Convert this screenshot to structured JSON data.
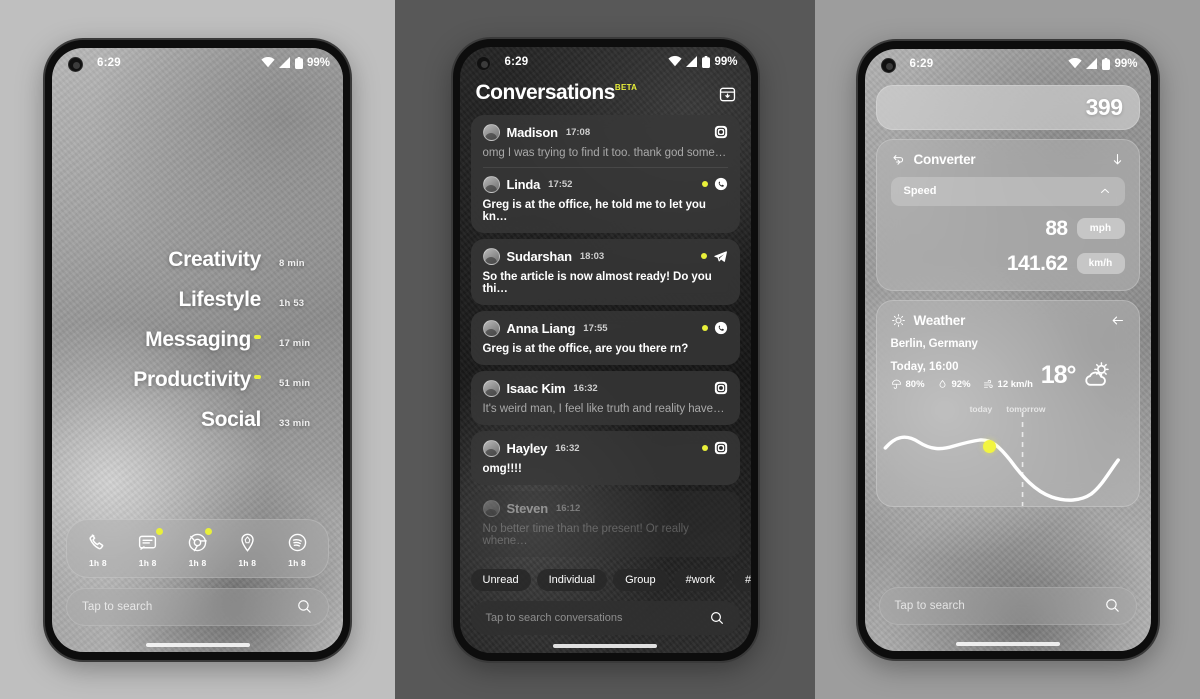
{
  "status_bar": {
    "time": "6:29",
    "battery": "99%",
    "wifi_icon": "wifi-icon",
    "signal_icon": "signal-icon",
    "battery_icon": "battery-icon"
  },
  "accent_color": "#e9f03a",
  "phone1": {
    "categories": [
      {
        "name": "Creativity",
        "time": "8 min",
        "dot": false
      },
      {
        "name": "Lifestyle",
        "time": "1h 53",
        "dot": false
      },
      {
        "name": "Messaging",
        "time": "17 min",
        "dot": true
      },
      {
        "name": "Productivity",
        "time": "51 min",
        "dot": true
      },
      {
        "name": "Social",
        "time": "33 min",
        "dot": false
      }
    ],
    "dock": [
      {
        "icon": "phone-icon",
        "label": "1h 8",
        "badge": false
      },
      {
        "icon": "messages-icon",
        "label": "1h 8",
        "badge": true
      },
      {
        "icon": "chrome-icon",
        "label": "1h 8",
        "badge": true
      },
      {
        "icon": "maps-icon",
        "label": "1h 8",
        "badge": false
      },
      {
        "icon": "spotify-icon",
        "label": "1h 8",
        "badge": false
      }
    ],
    "search": {
      "placeholder": "Tap to search",
      "icon": "search-icon"
    }
  },
  "phone2": {
    "header": {
      "title": "Conversations",
      "badge": "BETA",
      "archive_icon": "archive-icon"
    },
    "conversations": [
      {
        "name": "Madison",
        "time": "17:08",
        "message": "omg I was trying to find it too. thank god some…",
        "app_icon": "instagram-icon",
        "unread": false,
        "grouped_with_next": true
      },
      {
        "name": "Linda",
        "time": "17:52",
        "message": "Greg is at the office, he told me to let you kn…",
        "app_icon": "whatsapp-icon",
        "unread": true,
        "grouped_with_next": false
      },
      {
        "name": "Sudarshan",
        "time": "18:03",
        "message": "So the article is now almost ready! Do you thi…",
        "app_icon": "telegram-icon",
        "unread": true,
        "grouped_with_next": false
      },
      {
        "name": "Anna Liang",
        "time": "17:55",
        "message": "Greg is at the office, are you there rn?",
        "app_icon": "whatsapp-icon",
        "unread": true,
        "grouped_with_next": false
      },
      {
        "name": "Isaac Kim",
        "time": "16:32",
        "message": "It's weird man, I feel like truth and reality have…",
        "app_icon": "instagram-icon",
        "unread": false,
        "grouped_with_next": false
      },
      {
        "name": "Hayley",
        "time": "16:32",
        "message": "omg!!!!",
        "app_icon": "instagram-icon",
        "unread": true,
        "grouped_with_next": false
      },
      {
        "name": "Steven",
        "time": "16:12",
        "message": "No better time than the present! Or really whene…",
        "app_icon": "instagram-icon",
        "unread": false,
        "grouped_with_next": false
      }
    ],
    "filters": [
      "Unread",
      "Individual",
      "Group",
      "#work",
      "#fam"
    ],
    "search": {
      "placeholder": "Tap to search conversations",
      "icon": "search-icon"
    }
  },
  "phone3": {
    "calculator": {
      "value": "399"
    },
    "converter": {
      "title": "Converter",
      "icon": "convert-icon",
      "collapse_icon": "arrow-down-icon",
      "category": "Speed",
      "category_chevron": "chevron-up-icon",
      "rows": [
        {
          "value": "88",
          "unit": "mph"
        },
        {
          "value": "141.62",
          "unit": "km/h"
        }
      ]
    },
    "weather": {
      "title": "Weather",
      "icon": "sun-icon",
      "back_icon": "arrow-left-icon",
      "location": "Berlin, Germany",
      "time_label": "Today, 16:00",
      "stats": [
        {
          "icon": "umbrella-icon",
          "value": "80%"
        },
        {
          "icon": "humidity-icon",
          "value": "92%"
        },
        {
          "icon": "wind-icon",
          "value": "12 km/h"
        }
      ],
      "temperature": "18°",
      "condition_icon": "partly-cloudy-icon",
      "chart_labels": [
        "today",
        "tomorrow"
      ]
    },
    "search": {
      "placeholder": "Tap to search",
      "icon": "search-icon"
    }
  }
}
